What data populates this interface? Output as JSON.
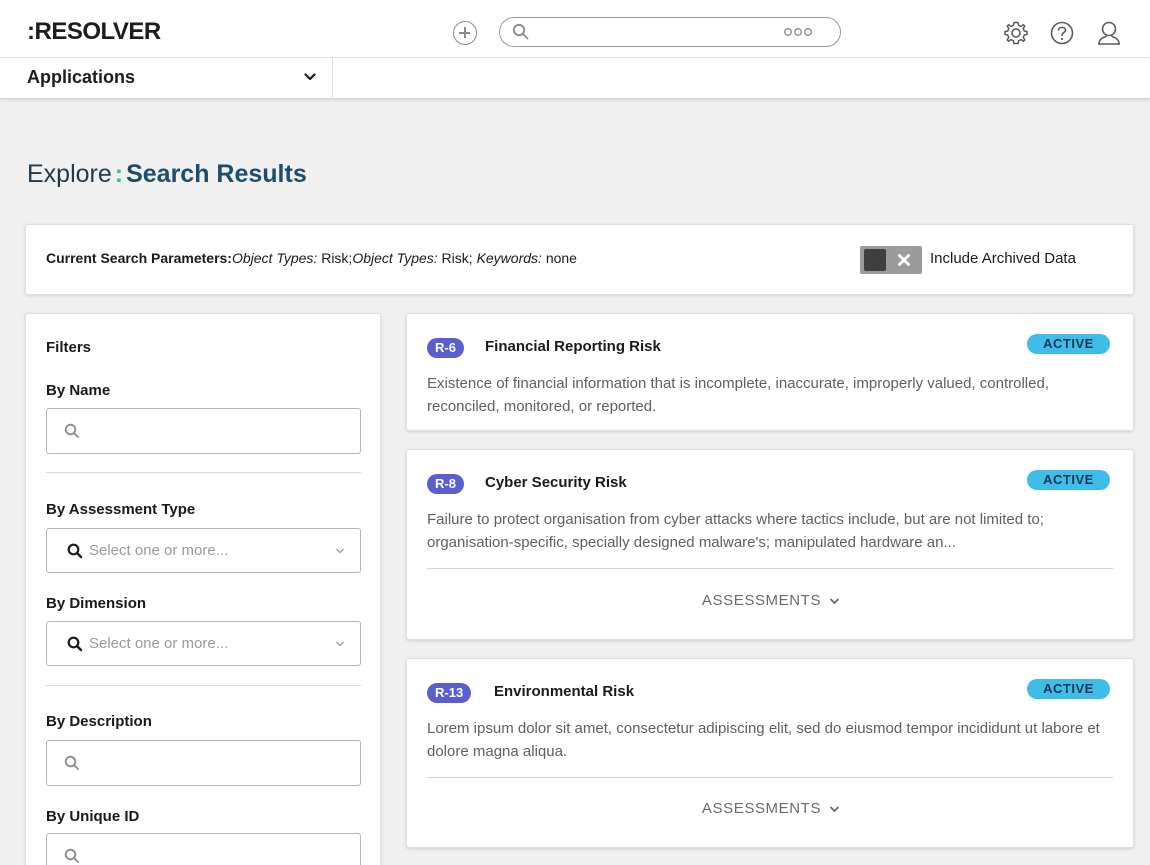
{
  "header": {
    "logo": ":RESOLVER",
    "search_placeholder": ""
  },
  "app_bar": {
    "dropdown_label": "Applications"
  },
  "page": {
    "title_prefix": "Explore",
    "title_main": "Search Results"
  },
  "params": {
    "label": "Current Search Parameters:",
    "k1": "Object Types:",
    "v1": "Risk;",
    "k2": "Object Types:",
    "v2": "Risk;",
    "k3": "Keywords:",
    "v3": "none",
    "toggle_label": "Include Archived Data",
    "toggle_on": false
  },
  "filters": {
    "title": "Filters",
    "by_name": "By Name",
    "by_assessment_type": "By Assessment Type",
    "by_dimension": "By Dimension",
    "by_description": "By Description",
    "by_unique_id": "By Unique ID",
    "select_placeholder": "Select one or more..."
  },
  "results": [
    {
      "id": "R-6",
      "title": "Financial Reporting Risk",
      "status": "ACTIVE",
      "description": "Existence of financial information that is incomplete, inaccurate, improperly valued, controlled, reconciled, monitored, or reported."
    },
    {
      "id": "R-8",
      "title": "Cyber Security Risk",
      "status": "ACTIVE",
      "description": "Failure to protect organisation from cyber attacks where tactics include, but are not limited to; organisation-specific, specially designed malware's; manipulated hardware an...",
      "assessments_label": "ASSESSMENTS"
    },
    {
      "id": "R-13",
      "title": "Environmental Risk",
      "status": "ACTIVE",
      "description": "Lorem ipsum dolor sit amet, consectetur adipiscing elit, sed do eiusmod tempor incididunt ut labore et dolore magna aliqua.",
      "assessments_label": "ASSESSMENTS"
    }
  ],
  "colors": {
    "id_badge": "#5a5fd0",
    "status_badge": "#3fbce8",
    "accent_green": "#37c67a",
    "title_blue": "#1e4d6b"
  }
}
